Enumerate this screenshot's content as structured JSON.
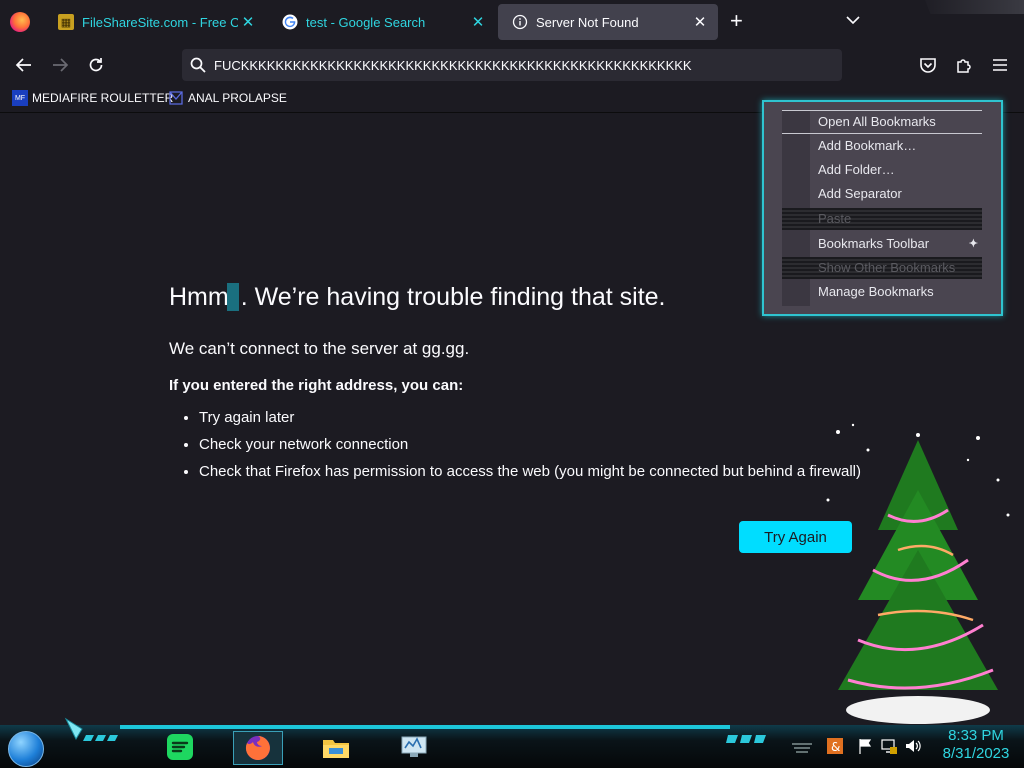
{
  "tabs": [
    {
      "title": "FileShareSite.com - Free Online",
      "favicon": "fileshare-icon",
      "active": false
    },
    {
      "title": "test - Google Search",
      "favicon": "google-icon",
      "active": false
    },
    {
      "title": "Server Not Found",
      "favicon": "info-icon",
      "active": true
    }
  ],
  "urlbar": {
    "value": "FUCKKKKKKKKKKKKKKKKKKKKKKKKKKKKKKKKKKKKKKKKKKKKKKKKKKKK"
  },
  "bookmarks": [
    {
      "label": "MEDIAFIRE ROULETTER",
      "icon_text": "MF T"
    },
    {
      "label": "ANAL PROLAPSE",
      "icon_text": ""
    }
  ],
  "error": {
    "title_before": "Hmm",
    "title_after": ". We’re having trouble finding that site.",
    "subtitle": "We can’t connect to the server at gg.gg.",
    "heading": "If you entered the right address, you can:",
    "items": [
      "Try again later",
      "Check your network connection",
      "Check that Firefox has permission to access the web (you might be connected but behind a firewall)"
    ],
    "button": "Try Again"
  },
  "context_menu": {
    "items": [
      {
        "label": "Open All Bookmarks",
        "disabled": false
      },
      {
        "label": "Add Bookmark…",
        "disabled": false
      },
      {
        "label": "Add Folder…",
        "disabled": false
      },
      {
        "label": "Add Separator",
        "disabled": false
      },
      {
        "label": "Paste",
        "disabled": true
      },
      {
        "label": "Bookmarks Toolbar",
        "disabled": false,
        "submenu": true
      },
      {
        "label": "Show Other Bookmarks",
        "disabled": true
      },
      {
        "label": "Manage Bookmarks",
        "disabled": false
      }
    ]
  },
  "taskbar": {
    "apps": [
      "spotify-icon",
      "firefox-icon",
      "file-explorer-icon",
      "task-manager-icon"
    ],
    "time": "8:33 PM",
    "date": "8/31/2023"
  },
  "colors": {
    "accent": "#00ddff",
    "tab_text": "#2fd5e0",
    "background": "#1c1b22"
  }
}
